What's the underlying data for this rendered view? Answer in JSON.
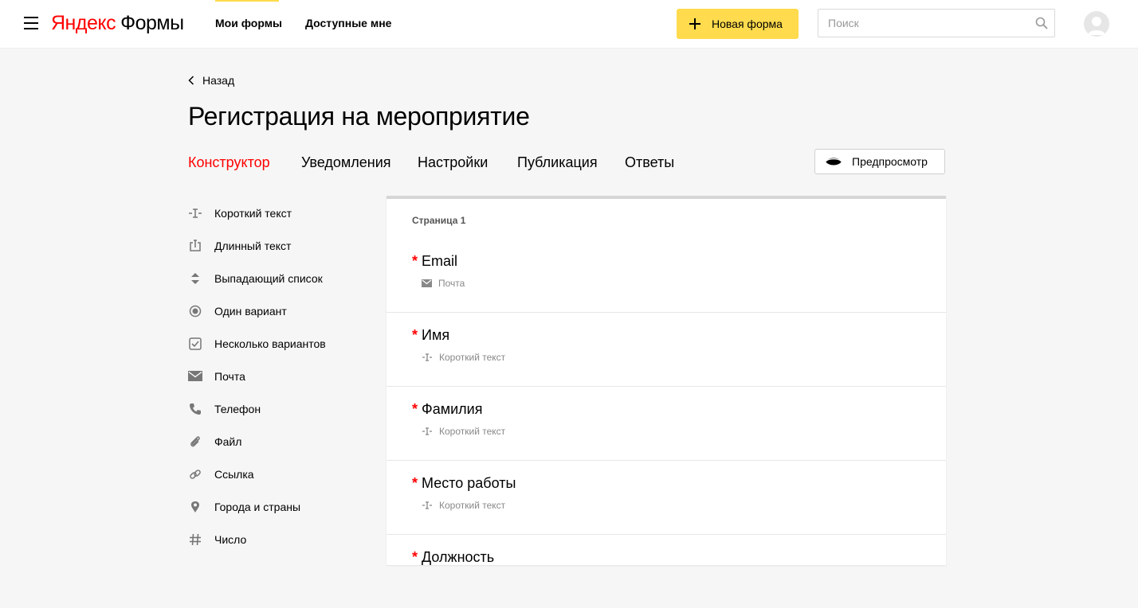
{
  "header": {
    "logo_brand": "Яндекс",
    "logo_product": "Формы",
    "nav": [
      "Мои формы",
      "Доступные мне"
    ],
    "new_form_label": "Новая форма",
    "search_placeholder": "Поиск"
  },
  "page": {
    "back_label": "Назад",
    "title": "Регистрация на мероприятие",
    "tabs": [
      {
        "label": "Конструктор",
        "active": true
      },
      {
        "label": "Уведомления",
        "active": false
      },
      {
        "label": "Настройки",
        "active": false
      },
      {
        "label": "Публикация",
        "active": false
      },
      {
        "label": "Ответы",
        "active": false
      }
    ],
    "preview_label": "Предпросмотр"
  },
  "sidebar": {
    "items": [
      {
        "label": "Короткий текст",
        "icon": "short-text-icon"
      },
      {
        "label": "Длинный текст",
        "icon": "long-text-icon"
      },
      {
        "label": "Выпадающий список",
        "icon": "dropdown-icon"
      },
      {
        "label": "Один вариант",
        "icon": "radio-icon"
      },
      {
        "label": "Несколько вариантов",
        "icon": "checkbox-icon"
      },
      {
        "label": "Почта",
        "icon": "mail-icon"
      },
      {
        "label": "Телефон",
        "icon": "phone-icon"
      },
      {
        "label": "Файл",
        "icon": "paperclip-icon"
      },
      {
        "label": "Ссылка",
        "icon": "link-icon"
      },
      {
        "label": "Города и страны",
        "icon": "location-pin-icon"
      },
      {
        "label": "Число",
        "icon": "hash-icon"
      }
    ]
  },
  "form": {
    "page_label": "Страница 1",
    "required_mark": "*",
    "fields": [
      {
        "name": "Email",
        "type": "Почта",
        "icon": "mail-icon"
      },
      {
        "name": "Имя",
        "type": "Короткий текст",
        "icon": "short-text-icon"
      },
      {
        "name": "Фамилия",
        "type": "Короткий текст",
        "icon": "short-text-icon"
      },
      {
        "name": "Место работы",
        "type": "Короткий текст",
        "icon": "short-text-icon"
      },
      {
        "name": "Должность",
        "type": "",
        "icon": ""
      }
    ]
  },
  "colors": {
    "accent_yellow": "#ffdb4d",
    "active_tab": "#ff0000",
    "required": "#ff0000"
  }
}
